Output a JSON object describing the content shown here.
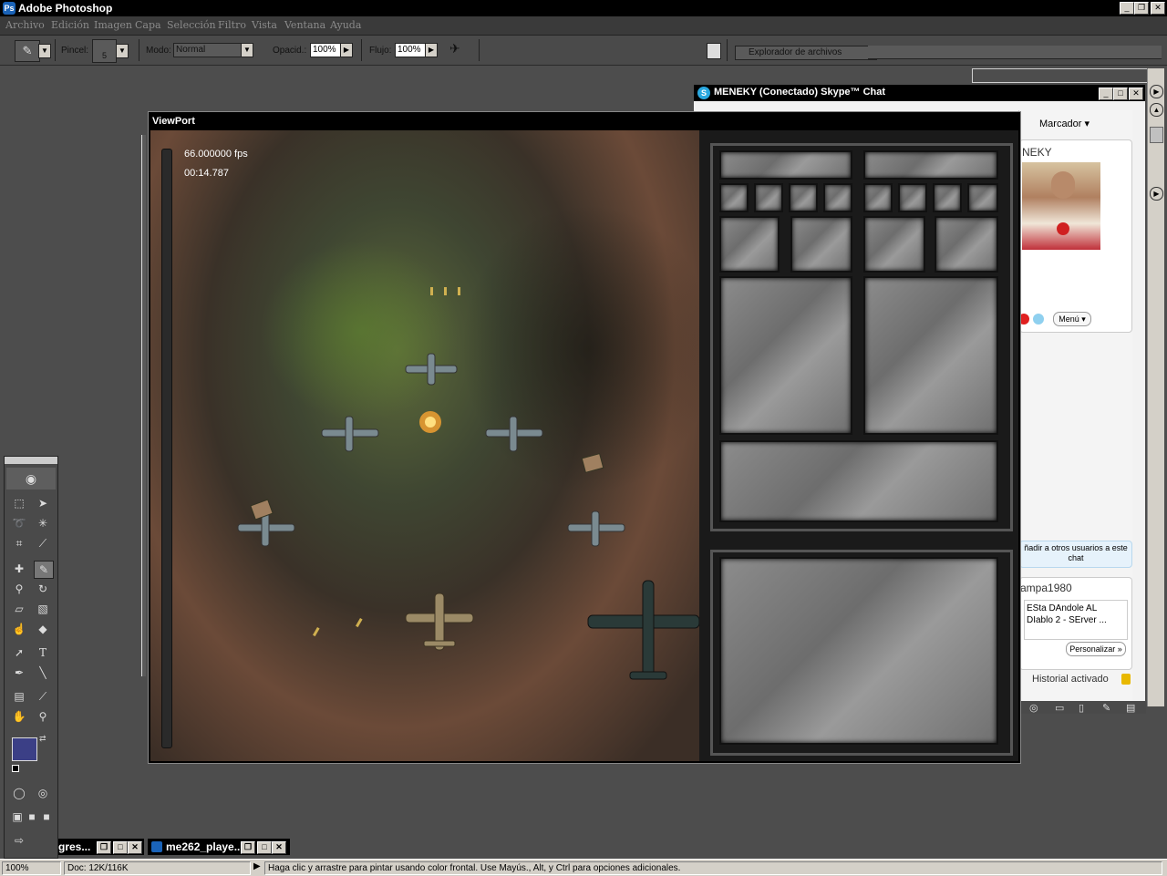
{
  "app": {
    "title": "Adobe Photoshop",
    "logo_glyph": "Ps"
  },
  "menu": [
    "Archivo",
    "Edición",
    "Imagen",
    "Capa",
    "Selección",
    "Filtro",
    "Vista",
    "Ventana",
    "Ayuda"
  ],
  "options": {
    "pincel_label": "Pincel:",
    "pincel_size": "5",
    "modo_label": "Modo:",
    "modo_value": "Normal",
    "opacidad_label": "Opacid.:",
    "opacidad_value": "100%",
    "flujo_label": "Flujo:",
    "flujo_value": "100%",
    "file_browser_tab": "Explorador de archivos"
  },
  "viewport": {
    "title": "ViewPort",
    "fps": "66.000000 fps",
    "time": "00:14.787"
  },
  "skype": {
    "title": "MENEKY (Conectado) Skype™ Chat",
    "marcador": "Marcador",
    "contact_name": "NEKY",
    "menu_button": "Menú",
    "add_users": "ñadir a otros usuarios a este chat",
    "user": "ampa1980",
    "message": "ESta DAndole AL DIablo 2 - SErver ...",
    "personalizar": "Personalizar »",
    "history": "Historial activado"
  },
  "documents": [
    {
      "name": "gres..."
    },
    {
      "name": "me262_playe..."
    }
  ],
  "status": {
    "zoom": "100%",
    "doc": "Doc: 12K/116K",
    "hint": "Haga clic y arrastre para pintar usando color frontal. Use Mayús., Alt, y Ctrl para opciones adicionales."
  },
  "colors": {
    "foreground": "#3b3f86",
    "background": "#ffffff"
  },
  "icons": [
    "brush-icon",
    "marquee-icon",
    "move-icon",
    "lasso-icon",
    "magic-wand-icon",
    "crop-icon",
    "slice-icon",
    "healing-icon",
    "pencil-icon",
    "stamp-icon",
    "history-brush-icon",
    "eraser-icon",
    "gradient-icon",
    "smudge-icon",
    "burn-icon",
    "path-select-icon",
    "type-icon",
    "pen-icon",
    "line-icon",
    "notes-icon",
    "eyedropper-icon",
    "hand-icon",
    "zoom-icon",
    "airbrush-icon"
  ]
}
